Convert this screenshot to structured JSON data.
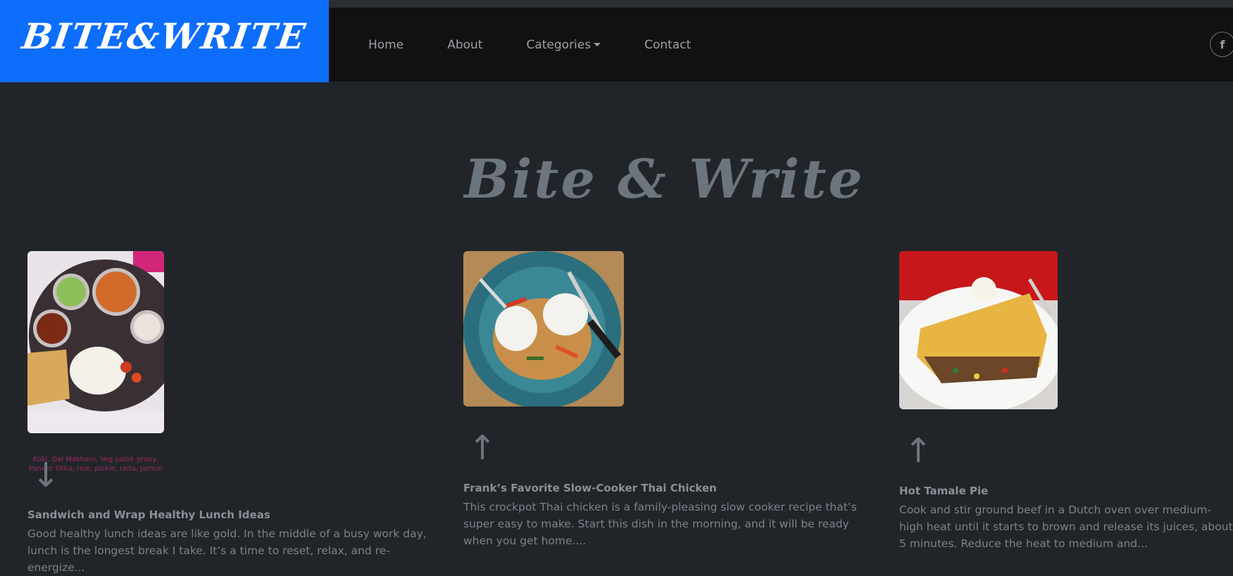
{
  "brand": "BITE&WRITE",
  "nav": {
    "items": [
      "Home",
      "About",
      "Categories",
      "Contact"
    ]
  },
  "social": {
    "facebook_icon": "f"
  },
  "hero": {
    "title": "Bite & Write"
  },
  "cards": [
    {
      "image_caption": "Koki, Dal Makhani, Veg palak gravy, Paneer tikka, rice, pickle, raita, Jamun",
      "arrow": "↓",
      "title": "Sandwich and Wrap Healthy Lunch Ideas",
      "text": "Good healthy lunch ideas are like gold. In the middle of a busy work day, lunch is the longest break I take. It’s a time to reset, relax, and re-energize..."
    },
    {
      "arrow": "↑",
      "title": "Frank’s Favorite Slow-Cooker Thai Chicken",
      "text": "This crockpot Thai chicken is a family-pleasing slow cooker recipe that’s super easy to make. Start this dish in the morning, and it will be ready when you get home...."
    },
    {
      "arrow": "↑",
      "title": "Hot Tamale Pie",
      "text": "Cook and stir ground beef in a Dutch oven over medium-high heat until it starts to brown and release its juices, about 5 minutes. Reduce the heat to medium and..."
    }
  ],
  "colors": {
    "brand_bg": "#0d6efd",
    "page_bg": "#212529",
    "navbar_bg": "#111111"
  }
}
